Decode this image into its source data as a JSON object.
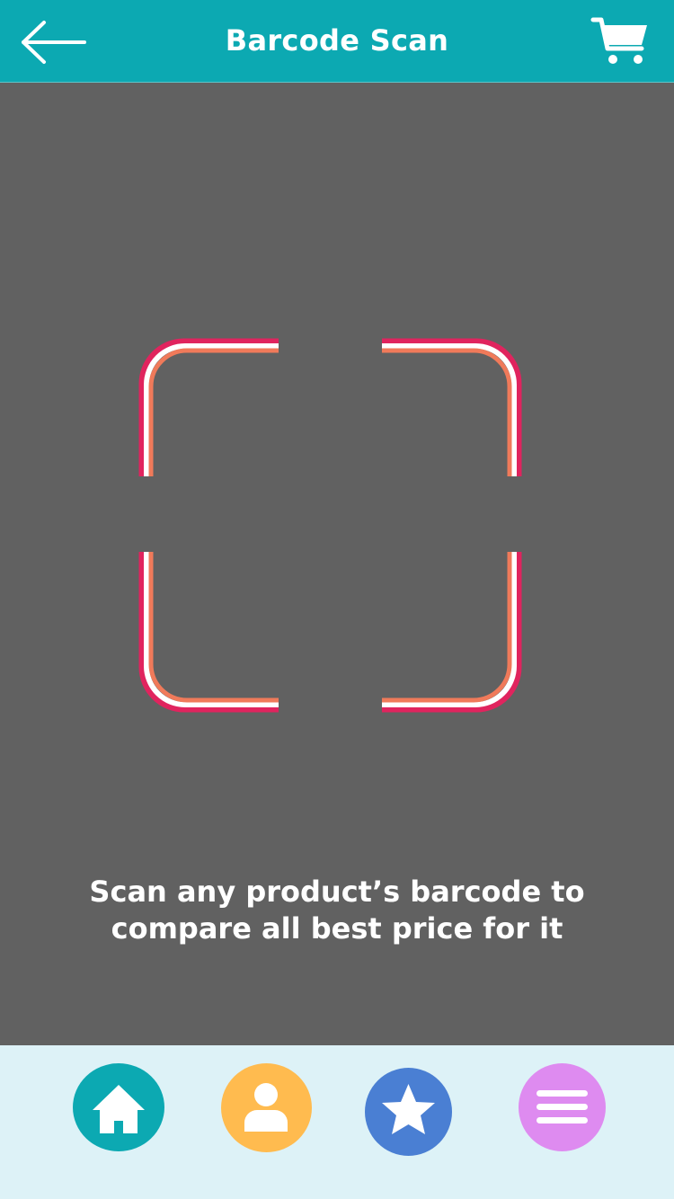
{
  "header": {
    "title": "Barcode Scan",
    "back_icon": "arrow-left-icon",
    "cart_icon": "shopping-cart-icon"
  },
  "scanner": {
    "instruction": "Scan any product’s barcode to compare all best price for it",
    "frame_colors": {
      "outer": "#E0245E",
      "middle": "#FFFFFF",
      "inner": "#F07A5A"
    }
  },
  "bottom_nav": {
    "items": [
      {
        "icon": "home-icon",
        "color": "#0CA9B2"
      },
      {
        "icon": "user-icon",
        "color": "#FFBB4F"
      },
      {
        "icon": "star-icon",
        "color": "#4A7FD3"
      },
      {
        "icon": "menu-icon",
        "color": "#DE8BF0"
      }
    ]
  },
  "colors": {
    "header_bg": "#0CA9B2",
    "scan_bg": "#616161",
    "nav_bg": "#DDF2F7"
  }
}
